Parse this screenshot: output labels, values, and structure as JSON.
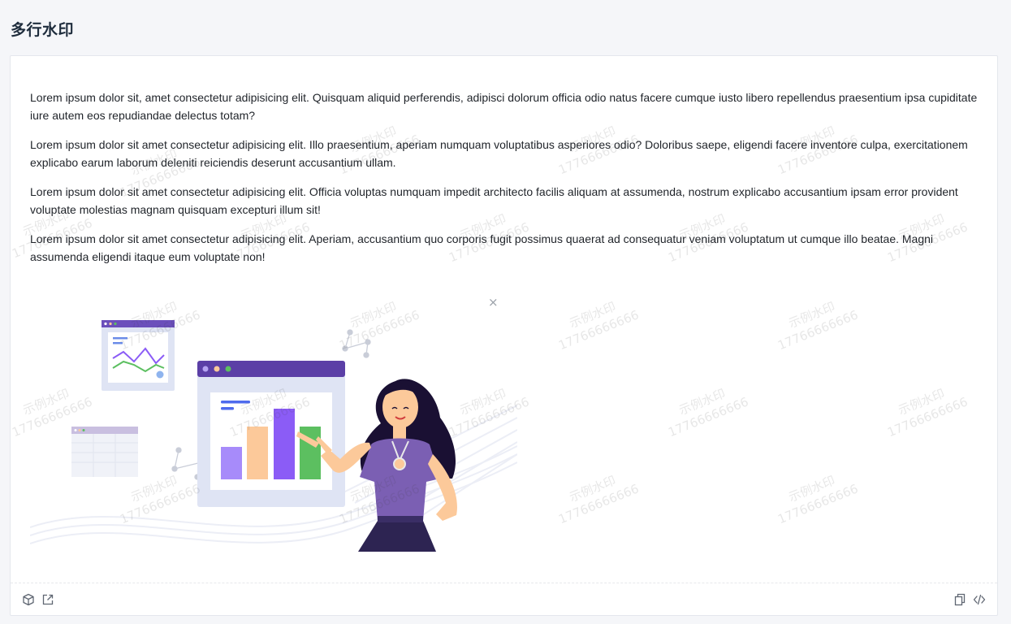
{
  "page": {
    "title": "多行水印"
  },
  "content": {
    "paragraphs": [
      "Lorem ipsum dolor sit, amet consectetur adipisicing elit. Quisquam aliquid perferendis, adipisci dolorum officia odio natus facere cumque iusto libero repellendus praesentium ipsa cupiditate iure autem eos repudiandae delectus totam?",
      "Lorem ipsum dolor sit amet consectetur adipisicing elit. Illo praesentium, aperiam numquam voluptatibus asperiores odio? Doloribus saepe, eligendi facere inventore culpa, exercitationem explicabo earum laborum deleniti reiciendis deserunt accusantium ullam.",
      "Lorem ipsum dolor sit amet consectetur adipisicing elit. Officia voluptas numquam impedit architecto facilis aliquam at assumenda, nostrum explicabo accusantium ipsam error provident voluptate molestias magnam quisquam excepturi illum sit!",
      "Lorem ipsum dolor sit amet consectetur adipisicing elit. Aperiam, accusantium quo corporis fugit possimus quaerat ad consequatur veniam voluptatum ut cumque illo beatae. Magni assumenda eligendi itaque eum voluptate non!"
    ],
    "close_glyph": "×"
  },
  "watermark": {
    "line1": "示例水印",
    "line2": "17766666666"
  },
  "footer": {
    "left_icons": [
      "cube-icon",
      "external-link-icon"
    ],
    "right_icons": [
      "copy-icon",
      "code-icon"
    ]
  },
  "colors": {
    "accent_purple": "#6b4fbb",
    "bar_purple": "#8b5cf6",
    "bar_peach": "#fcc99a",
    "bar_green": "#5cbf60",
    "window_blue": "#dfe4f4"
  }
}
